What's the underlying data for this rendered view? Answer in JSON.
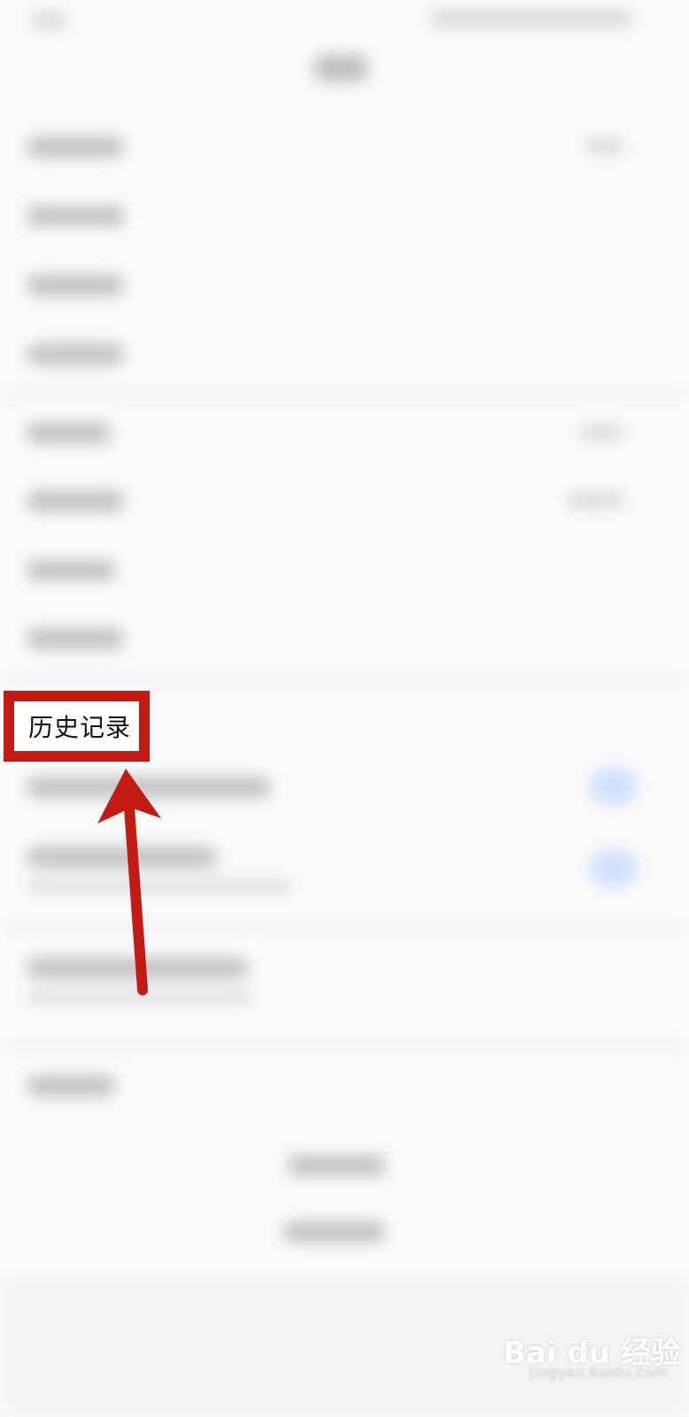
{
  "callout": {
    "label": "历史记录"
  },
  "colors": {
    "callout_border": "#c31b14",
    "arrow": "#c31b14",
    "page_background": "#fbfbfb"
  },
  "watermark": {
    "logo": "Bai du 经验",
    "url": "jingyan.baidu.com"
  },
  "icons": {
    "arrow": "up-arrow-icon"
  }
}
